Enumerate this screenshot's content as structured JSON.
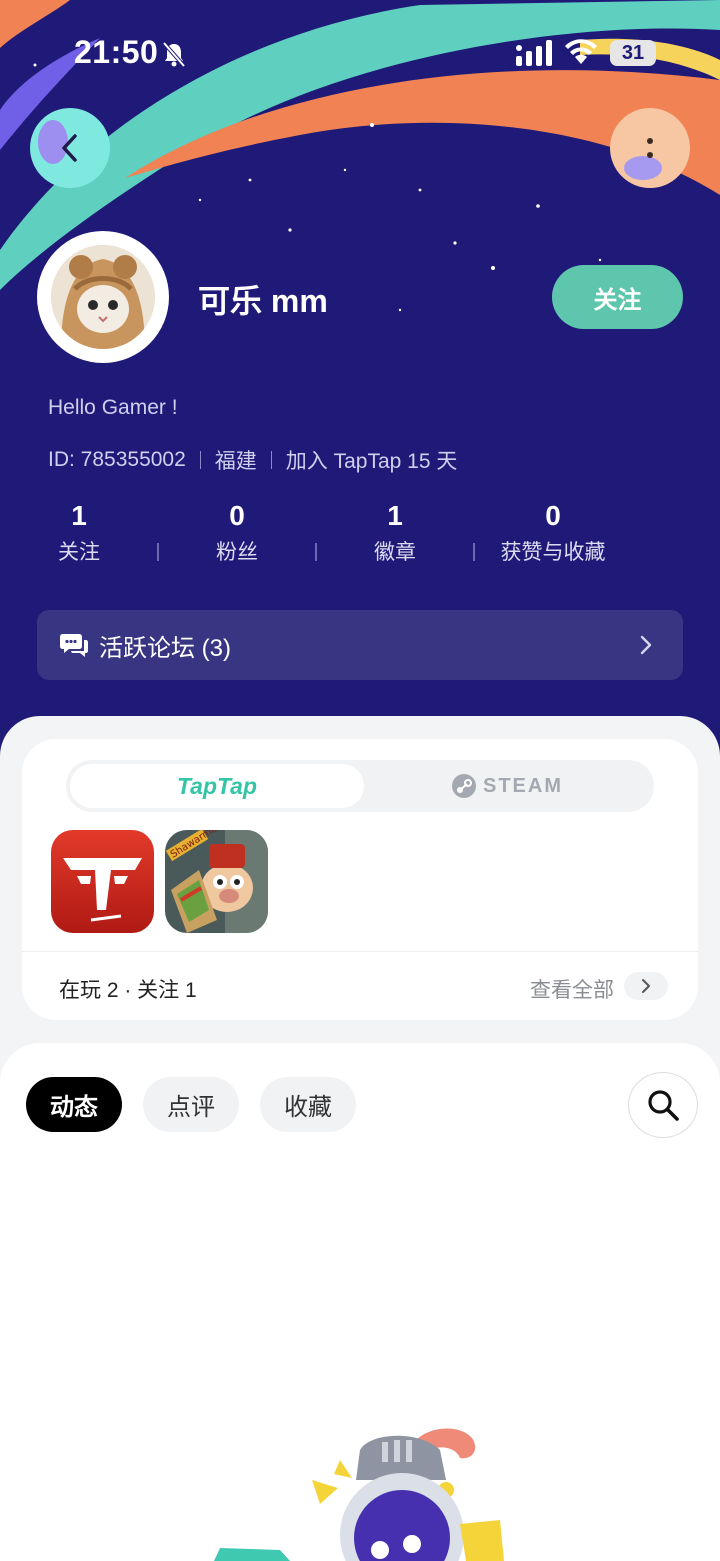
{
  "status_bar": {
    "time": "21:50",
    "battery": "31"
  },
  "profile": {
    "username": "可乐 mm",
    "follow_label": "关注",
    "bio": "Hello Gamer !",
    "id_text": "ID: 785355002",
    "location": "福建",
    "joined": "加入 TapTap 15 天"
  },
  "stats": [
    {
      "value": "1",
      "label": "关注"
    },
    {
      "value": "0",
      "label": "粉丝"
    },
    {
      "value": "1",
      "label": "徽章"
    },
    {
      "value": "0",
      "label": "获赞与收藏"
    }
  ],
  "forum": {
    "label": "活跃论坛 (3)"
  },
  "games_card": {
    "tabs": {
      "taptap": "TapTap",
      "steam": "STEAM"
    },
    "game_icon_text": {
      "game_2_banner": "Shawarma"
    },
    "summary": "在玩 2 · 关注 1",
    "view_all": "查看全部"
  },
  "feed": {
    "tabs": [
      "动态",
      "点评",
      "收藏"
    ],
    "active_tab": "动态"
  },
  "colors": {
    "hero_bg": "#1f1a78",
    "accent_green": "#5ec6ad",
    "taptap_green": "#34c4a6"
  }
}
